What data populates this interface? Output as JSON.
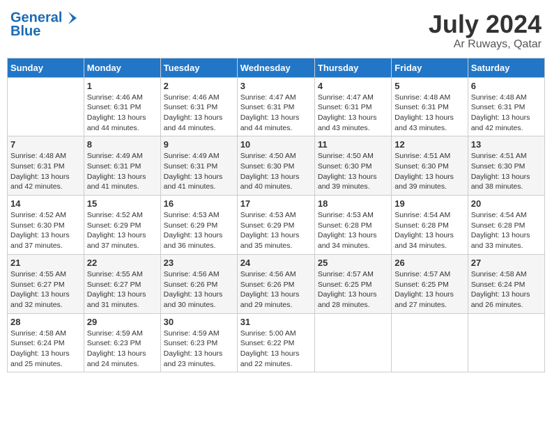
{
  "header": {
    "logo_line1": "General",
    "logo_line2": "Blue",
    "month_year": "July 2024",
    "location": "Ar Ruways, Qatar"
  },
  "days_of_week": [
    "Sunday",
    "Monday",
    "Tuesday",
    "Wednesday",
    "Thursday",
    "Friday",
    "Saturday"
  ],
  "weeks": [
    [
      {
        "day": "",
        "sunrise": "",
        "sunset": "",
        "daylight": ""
      },
      {
        "day": "1",
        "sunrise": "Sunrise: 4:46 AM",
        "sunset": "Sunset: 6:31 PM",
        "daylight": "Daylight: 13 hours and 44 minutes."
      },
      {
        "day": "2",
        "sunrise": "Sunrise: 4:46 AM",
        "sunset": "Sunset: 6:31 PM",
        "daylight": "Daylight: 13 hours and 44 minutes."
      },
      {
        "day": "3",
        "sunrise": "Sunrise: 4:47 AM",
        "sunset": "Sunset: 6:31 PM",
        "daylight": "Daylight: 13 hours and 44 minutes."
      },
      {
        "day": "4",
        "sunrise": "Sunrise: 4:47 AM",
        "sunset": "Sunset: 6:31 PM",
        "daylight": "Daylight: 13 hours and 43 minutes."
      },
      {
        "day": "5",
        "sunrise": "Sunrise: 4:48 AM",
        "sunset": "Sunset: 6:31 PM",
        "daylight": "Daylight: 13 hours and 43 minutes."
      },
      {
        "day": "6",
        "sunrise": "Sunrise: 4:48 AM",
        "sunset": "Sunset: 6:31 PM",
        "daylight": "Daylight: 13 hours and 42 minutes."
      }
    ],
    [
      {
        "day": "7",
        "sunrise": "Sunrise: 4:48 AM",
        "sunset": "Sunset: 6:31 PM",
        "daylight": "Daylight: 13 hours and 42 minutes."
      },
      {
        "day": "8",
        "sunrise": "Sunrise: 4:49 AM",
        "sunset": "Sunset: 6:31 PM",
        "daylight": "Daylight: 13 hours and 41 minutes."
      },
      {
        "day": "9",
        "sunrise": "Sunrise: 4:49 AM",
        "sunset": "Sunset: 6:31 PM",
        "daylight": "Daylight: 13 hours and 41 minutes."
      },
      {
        "day": "10",
        "sunrise": "Sunrise: 4:50 AM",
        "sunset": "Sunset: 6:30 PM",
        "daylight": "Daylight: 13 hours and 40 minutes."
      },
      {
        "day": "11",
        "sunrise": "Sunrise: 4:50 AM",
        "sunset": "Sunset: 6:30 PM",
        "daylight": "Daylight: 13 hours and 39 minutes."
      },
      {
        "day": "12",
        "sunrise": "Sunrise: 4:51 AM",
        "sunset": "Sunset: 6:30 PM",
        "daylight": "Daylight: 13 hours and 39 minutes."
      },
      {
        "day": "13",
        "sunrise": "Sunrise: 4:51 AM",
        "sunset": "Sunset: 6:30 PM",
        "daylight": "Daylight: 13 hours and 38 minutes."
      }
    ],
    [
      {
        "day": "14",
        "sunrise": "Sunrise: 4:52 AM",
        "sunset": "Sunset: 6:30 PM",
        "daylight": "Daylight: 13 hours and 37 minutes."
      },
      {
        "day": "15",
        "sunrise": "Sunrise: 4:52 AM",
        "sunset": "Sunset: 6:29 PM",
        "daylight": "Daylight: 13 hours and 37 minutes."
      },
      {
        "day": "16",
        "sunrise": "Sunrise: 4:53 AM",
        "sunset": "Sunset: 6:29 PM",
        "daylight": "Daylight: 13 hours and 36 minutes."
      },
      {
        "day": "17",
        "sunrise": "Sunrise: 4:53 AM",
        "sunset": "Sunset: 6:29 PM",
        "daylight": "Daylight: 13 hours and 35 minutes."
      },
      {
        "day": "18",
        "sunrise": "Sunrise: 4:53 AM",
        "sunset": "Sunset: 6:28 PM",
        "daylight": "Daylight: 13 hours and 34 minutes."
      },
      {
        "day": "19",
        "sunrise": "Sunrise: 4:54 AM",
        "sunset": "Sunset: 6:28 PM",
        "daylight": "Daylight: 13 hours and 34 minutes."
      },
      {
        "day": "20",
        "sunrise": "Sunrise: 4:54 AM",
        "sunset": "Sunset: 6:28 PM",
        "daylight": "Daylight: 13 hours and 33 minutes."
      }
    ],
    [
      {
        "day": "21",
        "sunrise": "Sunrise: 4:55 AM",
        "sunset": "Sunset: 6:27 PM",
        "daylight": "Daylight: 13 hours and 32 minutes."
      },
      {
        "day": "22",
        "sunrise": "Sunrise: 4:55 AM",
        "sunset": "Sunset: 6:27 PM",
        "daylight": "Daylight: 13 hours and 31 minutes."
      },
      {
        "day": "23",
        "sunrise": "Sunrise: 4:56 AM",
        "sunset": "Sunset: 6:26 PM",
        "daylight": "Daylight: 13 hours and 30 minutes."
      },
      {
        "day": "24",
        "sunrise": "Sunrise: 4:56 AM",
        "sunset": "Sunset: 6:26 PM",
        "daylight": "Daylight: 13 hours and 29 minutes."
      },
      {
        "day": "25",
        "sunrise": "Sunrise: 4:57 AM",
        "sunset": "Sunset: 6:25 PM",
        "daylight": "Daylight: 13 hours and 28 minutes."
      },
      {
        "day": "26",
        "sunrise": "Sunrise: 4:57 AM",
        "sunset": "Sunset: 6:25 PM",
        "daylight": "Daylight: 13 hours and 27 minutes."
      },
      {
        "day": "27",
        "sunrise": "Sunrise: 4:58 AM",
        "sunset": "Sunset: 6:24 PM",
        "daylight": "Daylight: 13 hours and 26 minutes."
      }
    ],
    [
      {
        "day": "28",
        "sunrise": "Sunrise: 4:58 AM",
        "sunset": "Sunset: 6:24 PM",
        "daylight": "Daylight: 13 hours and 25 minutes."
      },
      {
        "day": "29",
        "sunrise": "Sunrise: 4:59 AM",
        "sunset": "Sunset: 6:23 PM",
        "daylight": "Daylight: 13 hours and 24 minutes."
      },
      {
        "day": "30",
        "sunrise": "Sunrise: 4:59 AM",
        "sunset": "Sunset: 6:23 PM",
        "daylight": "Daylight: 13 hours and 23 minutes."
      },
      {
        "day": "31",
        "sunrise": "Sunrise: 5:00 AM",
        "sunset": "Sunset: 6:22 PM",
        "daylight": "Daylight: 13 hours and 22 minutes."
      },
      {
        "day": "",
        "sunrise": "",
        "sunset": "",
        "daylight": ""
      },
      {
        "day": "",
        "sunrise": "",
        "sunset": "",
        "daylight": ""
      },
      {
        "day": "",
        "sunrise": "",
        "sunset": "",
        "daylight": ""
      }
    ]
  ]
}
